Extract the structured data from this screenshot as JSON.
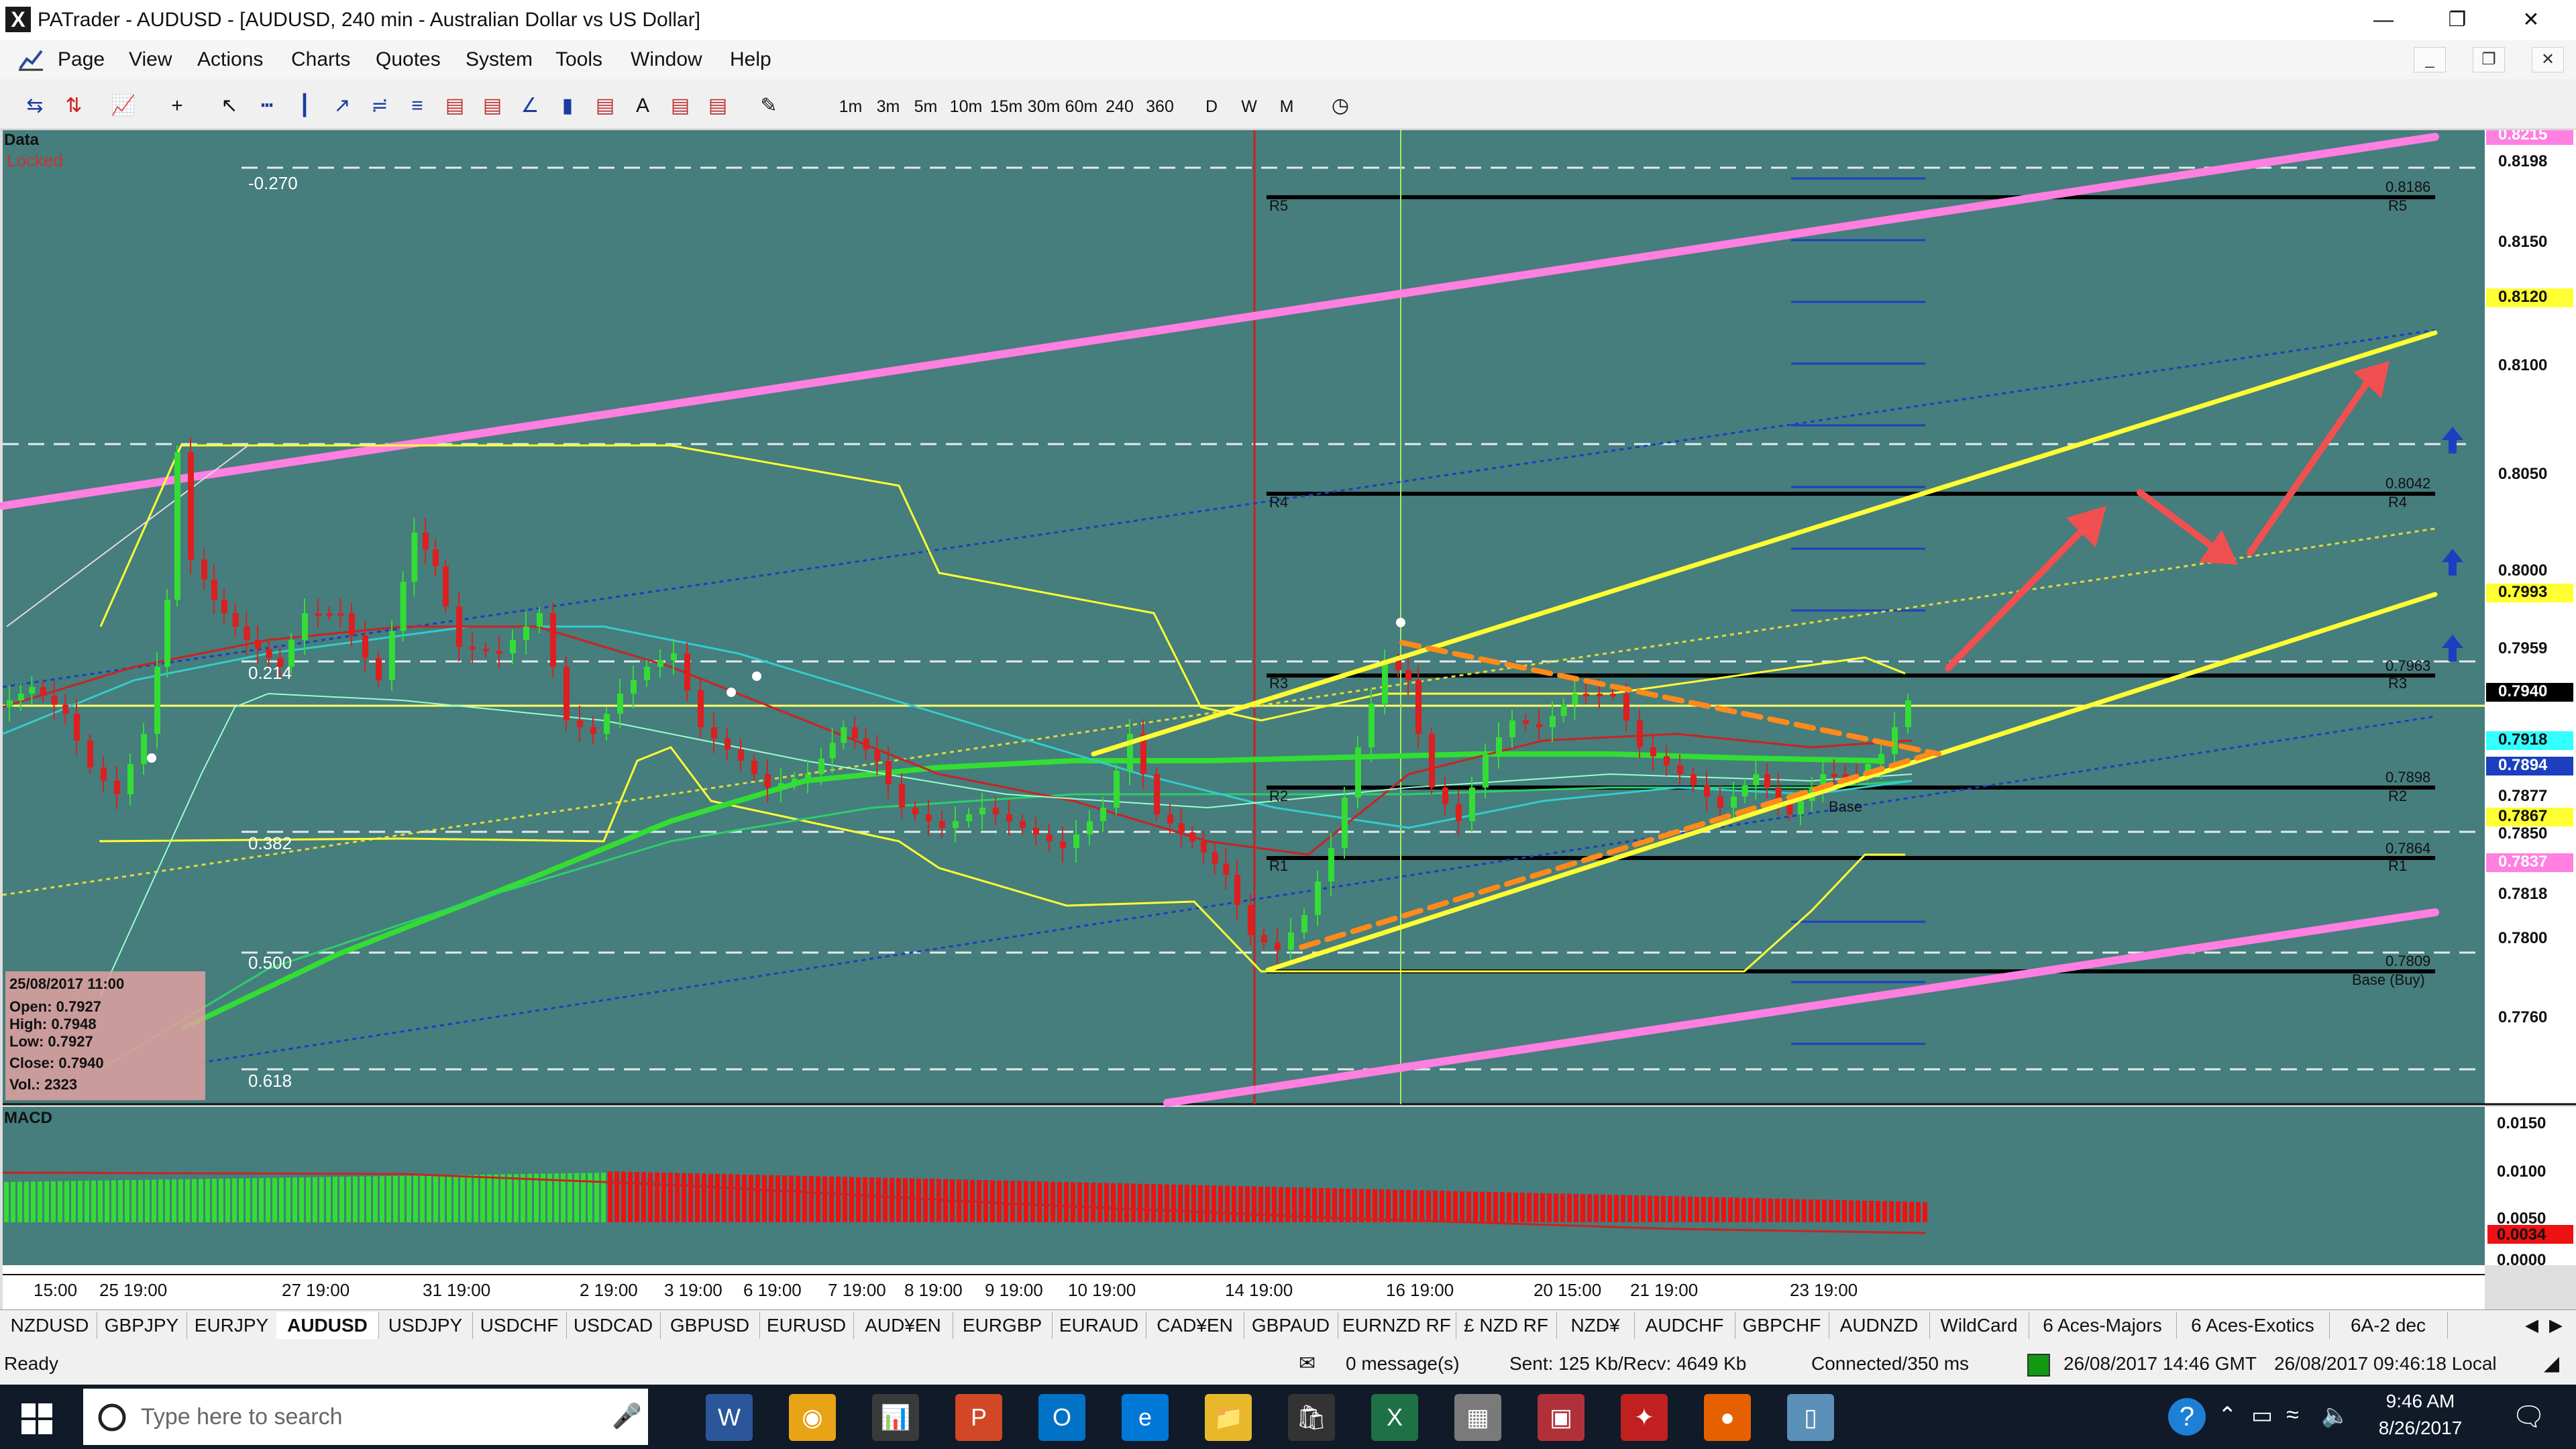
{
  "window": {
    "title": "PATrader - AUDUSD - [AUDUSD, 240 min - Australian Dollar vs US Dollar]",
    "icon": "X",
    "controls": [
      "minimize-icon",
      "restore-icon",
      "close-icon"
    ]
  },
  "menu": [
    "Page",
    "View",
    "Actions",
    "Charts",
    "Quotes",
    "System",
    "Tools",
    "Window",
    "Help"
  ],
  "mdi_controls": [
    "minimize-icon",
    "restore-icon",
    "close-icon"
  ],
  "toolbar": {
    "timeframes": [
      "1m",
      "3m",
      "5m",
      "10m",
      "15m",
      "30m",
      "60m",
      "240",
      "360"
    ],
    "periods": [
      "D",
      "W",
      "M"
    ]
  },
  "chart": {
    "data_label": "Data",
    "locked_label": "Locked",
    "fib_labels": [
      "-0.270",
      "0.214",
      "0.382",
      "0.500",
      "0.618"
    ],
    "pivot_labels": [
      "R5",
      "R4",
      "R3",
      "R2",
      "R1",
      "Base (Buy)",
      "Base"
    ],
    "pivot_values": [
      "0.8186",
      "0.8042",
      "0.7963",
      "0.7898",
      "0.7864",
      "0.7809"
    ],
    "price_axis": [
      "0.8215",
      "0.8198",
      "0.8150",
      "0.8120",
      "0.8100",
      "0.8050",
      "0.8000",
      "0.7993",
      "0.7959",
      "0.7940",
      "0.7918",
      "0.7894",
      "0.7877",
      "0.7867",
      "0.7850",
      "0.7837",
      "0.7818",
      "0.7800",
      "0.7760"
    ],
    "date_axis": [
      "15:00",
      "25 19:00",
      "27 19:00",
      "31 19:00",
      "2 19:00",
      "3 19:00",
      "6 19:00",
      "7 19:00",
      "8 19:00",
      "9 19:00",
      "10 19:00",
      "14 19:00",
      "16 19:00",
      "20 15:00",
      "21 19:00",
      "23 19:00"
    ],
    "info_box": {
      "date": "25/08/2017 11:00",
      "open": "Open: 0.7927",
      "high": "High: 0.7948",
      "low": "Low: 0.7927",
      "close": "Close: 0.7940",
      "vol": "Vol.: 2323"
    },
    "macd_label": "MACD",
    "macd_axis": [
      "0.0150",
      "0.0100",
      "0.0050",
      "0.0034",
      "0.0000"
    ],
    "colors": {
      "background": "#467d7d",
      "bull": "#33dd33",
      "bear": "#dd1f1f",
      "channel": "#ff80e0",
      "trend": "#ffff33",
      "wedge": "#ff8a1a",
      "arrows": "#f05050"
    }
  },
  "tabs": [
    "NZDUSD",
    "GBPJPY",
    "EURJPY",
    "AUDUSD",
    "USDJPY",
    "USDCHF",
    "USDCAD",
    "GBPUSD",
    "EURUSD",
    "AUD¥EN",
    "EURGBP",
    "EURAUD",
    "CAD¥EN",
    "GBPAUD",
    "EURNZD RF",
    "£ NZD RF",
    "NZD¥",
    "AUDCHF",
    "GBPCHF",
    "AUDNZD",
    "WildCard",
    "6 Aces-Majors",
    "6 Aces-Exotics",
    "6A-2 dec"
  ],
  "active_tab": "AUDUSD",
  "status": {
    "ready": "Ready",
    "messages": "0 message(s)",
    "traffic": "Sent: 125 Kb/Recv: 4649 Kb",
    "connection": "Connected/350 ms",
    "gmt": "26/08/2017 14:46 GMT",
    "local": "26/08/2017 09:46:18 Local"
  },
  "taskbar": {
    "search_placeholder": "Type here to search",
    "time": "9:46 AM",
    "date": "8/26/2017",
    "apps": [
      "word-icon",
      "chrome-icon",
      "patrader-icon",
      "powerpoint-icon",
      "outlook-icon",
      "edge-icon",
      "file-explorer-icon",
      "store-icon",
      "excel-icon",
      "calculator-icon",
      "pdf-icon",
      "bird-app-icon",
      "firefox-icon",
      "notes-icon"
    ]
  }
}
